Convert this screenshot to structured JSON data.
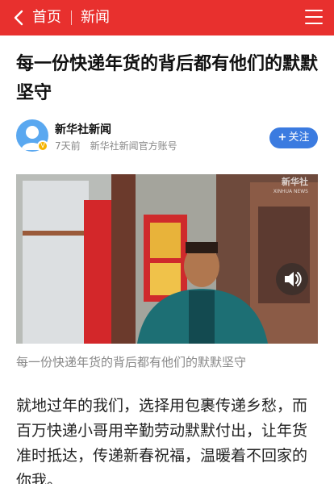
{
  "nav": {
    "back_icon": "chevron-left-icon",
    "home_label": "首页",
    "channel_label": "新闻",
    "menu_icon": "hamburger-menu-icon",
    "bar_color": "#e8302e"
  },
  "article": {
    "title": "每一份快递年货的背后都有他们的默默坚守",
    "author": {
      "name": "新华社新闻",
      "time": "7天前",
      "description": "新华社新闻官方账号",
      "follow_label": "关注",
      "verified_icon": "verified-badge-icon"
    },
    "video": {
      "watermark": "新华社",
      "watermark_sub": "XINHUA NEWS",
      "volume_icon": "speaker-icon"
    },
    "caption": "每一份快递年货的背后都有他们的默默坚守",
    "body": "就地过年的我们，选择用包裹传递乡愁，而百万快递小哥用辛勤劳动默默付出，让年货准时抵达，传递新春祝福，温暖着不回家的你我。"
  },
  "colors": {
    "follow_button": "#3b7be0",
    "avatar": "#5aa8f0",
    "caption_text": "#888888"
  }
}
